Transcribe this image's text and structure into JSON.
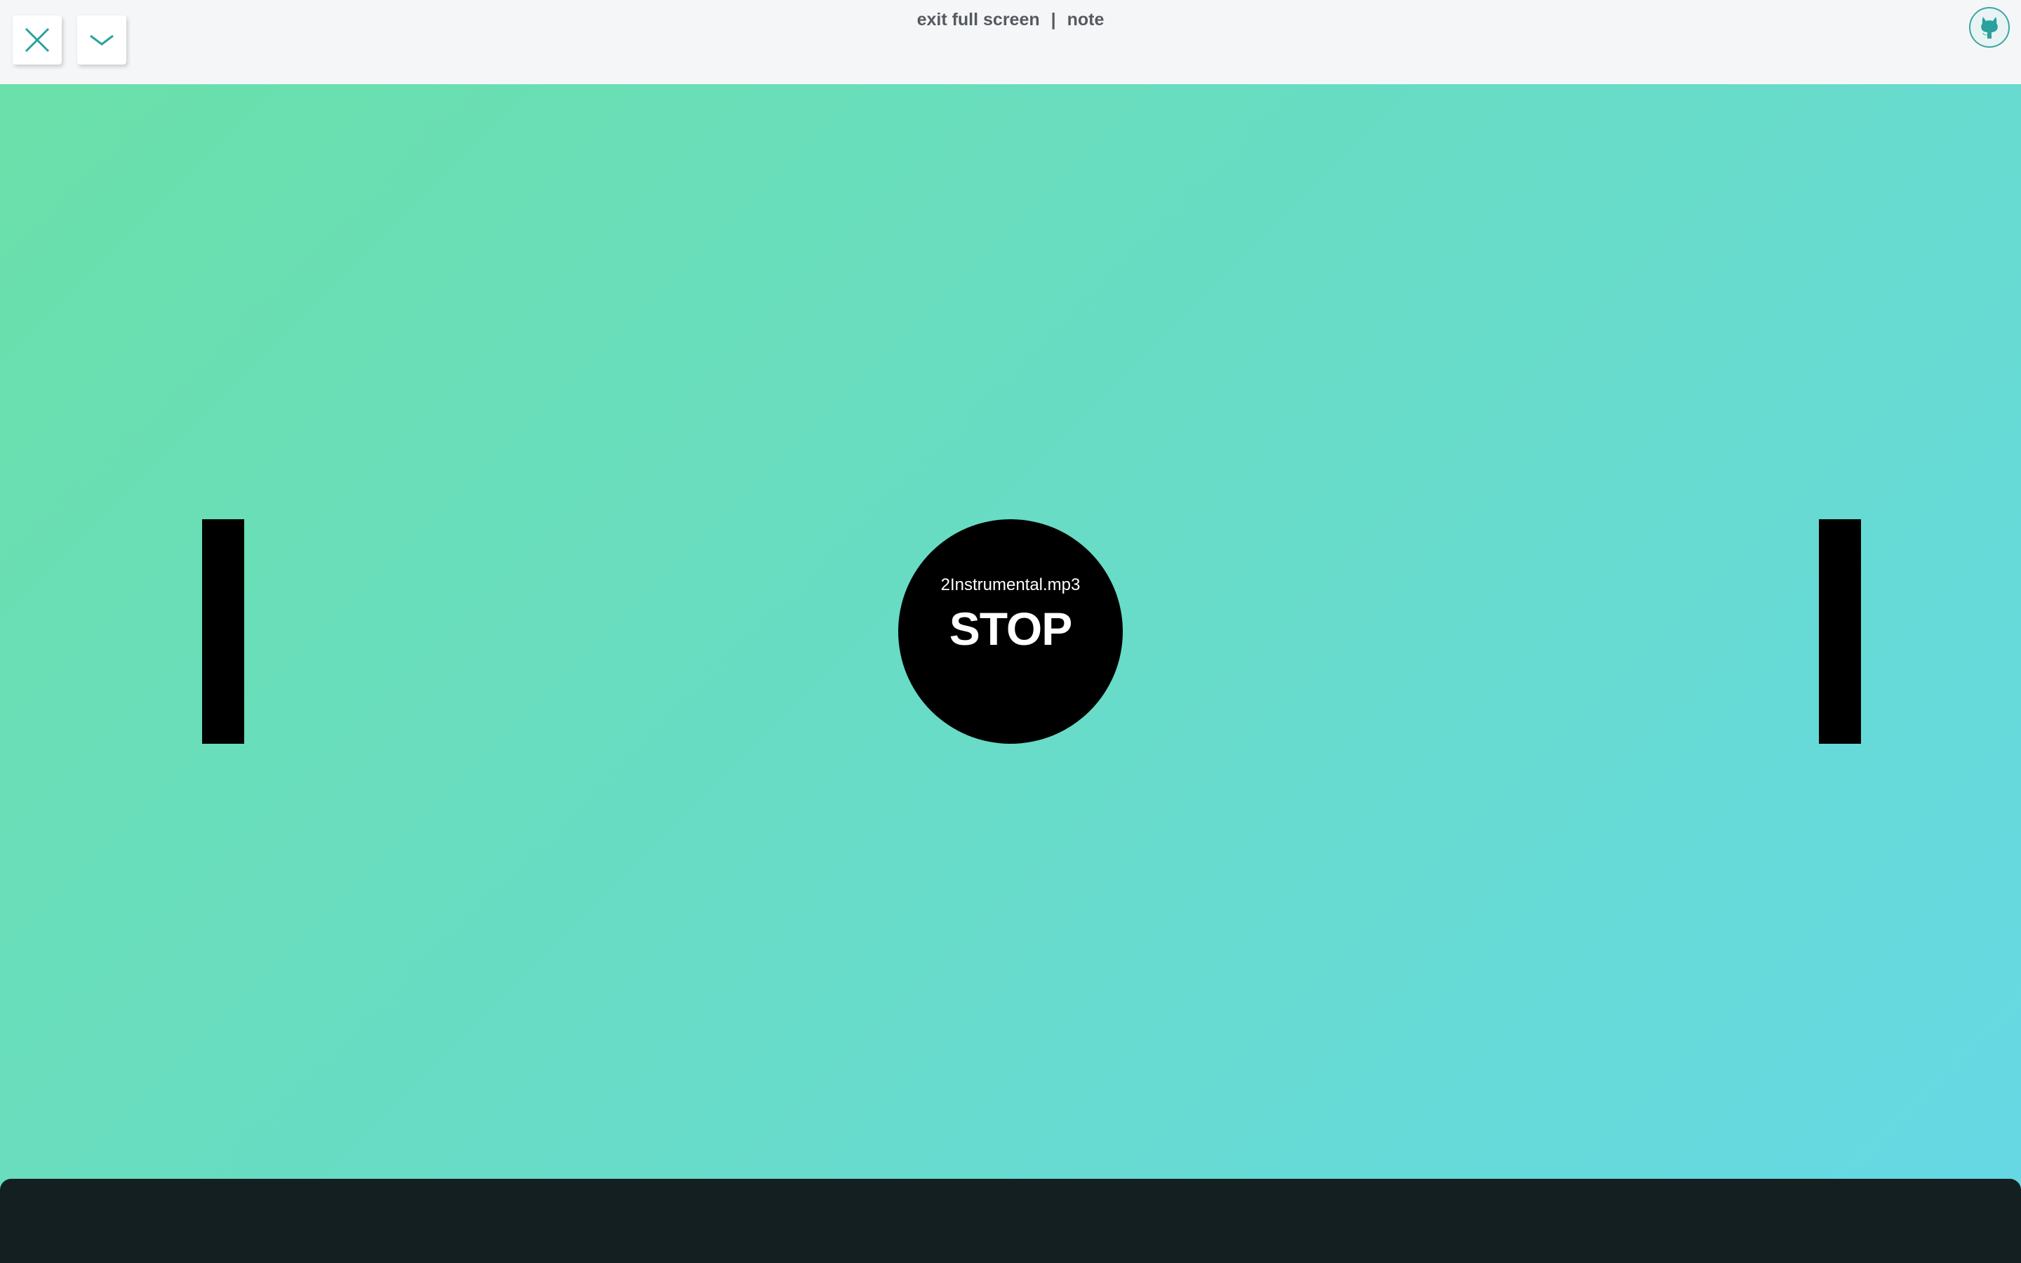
{
  "topbar": {
    "exit_label": "exit full screen",
    "separator": "|",
    "note_label": "note"
  },
  "icons": {
    "close": "close-icon",
    "collapse": "chevron-down-icon",
    "github": "github-icon"
  },
  "player": {
    "filename": "2Instrumental.mp3",
    "action_label": "STOP"
  },
  "colors": {
    "accent": "#2aa19c",
    "gradient_start": "#6be0a8",
    "gradient_end": "#65d8e6",
    "panel": "#141f21"
  }
}
